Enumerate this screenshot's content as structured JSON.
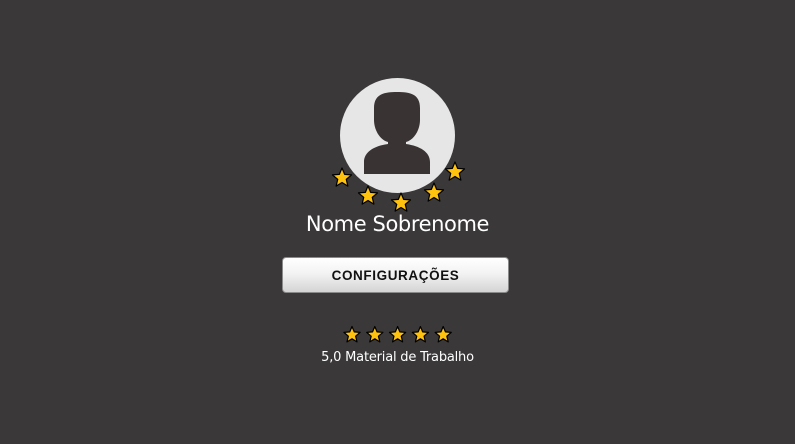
{
  "profile": {
    "name": "Nome Sobrenome",
    "avatar_icon": "user-silhouette-icon",
    "avatar_star_count": 5
  },
  "settings_button": {
    "label": "CONFIGURAÇÕES"
  },
  "rating": {
    "value_text": "5,0",
    "category": "Material de Trabalho",
    "stars_filled": 5,
    "stars_total": 5,
    "star_icon": "star-icon"
  },
  "colors": {
    "background": "#3a3839",
    "star_fill": "#ffc20e",
    "avatar_bg": "#e6e6e6",
    "silhouette": "#3a3334"
  }
}
